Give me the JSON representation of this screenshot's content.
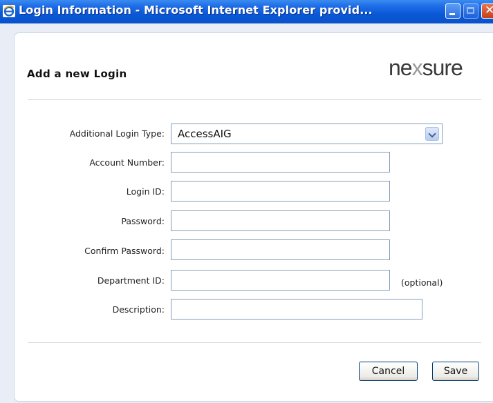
{
  "window": {
    "title": "Login Information - Microsoft Internet Explorer provid..."
  },
  "header": {
    "heading": "Add a new Login",
    "logo_text_pre": "ne",
    "logo_text_x": "x",
    "logo_text_post": "sure"
  },
  "form": {
    "login_type": {
      "label": "Additional Login Type:",
      "value": "AccessAIG"
    },
    "account_number": {
      "label": "Account Number:",
      "value": ""
    },
    "login_id": {
      "label": "Login ID:",
      "value": ""
    },
    "password": {
      "label": "Password:",
      "value": ""
    },
    "confirm_password": {
      "label": "Confirm Password:",
      "value": ""
    },
    "department_id": {
      "label": "Department ID:",
      "value": "",
      "note": "(optional)"
    },
    "description": {
      "label": "Description:",
      "value": ""
    }
  },
  "actions": {
    "cancel_label": "Cancel",
    "save_label": "Save"
  },
  "icons": {
    "app": "internet-explorer-icon",
    "minimize": "minimize-icon",
    "maximize": "maximize-icon",
    "close": "close-icon",
    "dropdown": "chevron-down-icon"
  },
  "colors": {
    "titlebar": "#0a58d6",
    "field_border": "#7f9db9",
    "button_border": "#003c74"
  }
}
